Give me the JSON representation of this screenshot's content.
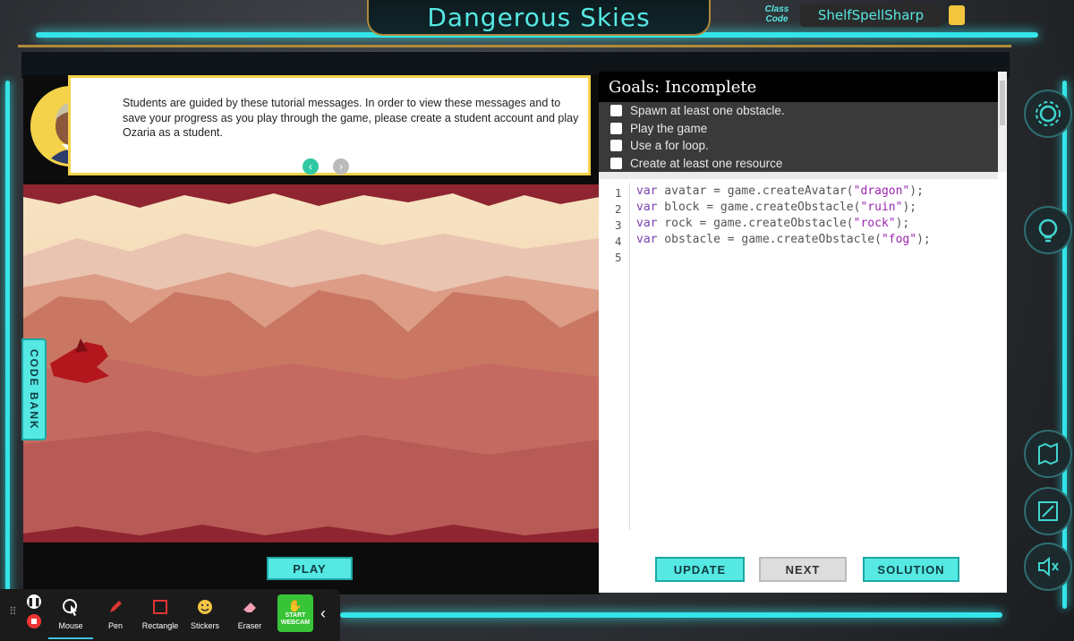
{
  "header": {
    "title": "Dangerous Skies",
    "class_code_label": "Class Code",
    "class_code": "ShelfSpellSharp"
  },
  "tutorial": {
    "message": "Students are guided by these tutorial messages. In order to view these messages and to save your progress as you play through the game, please create a student account and play Ozaria as a student."
  },
  "game": {
    "code_bank_label": "CODE BANK",
    "play_label": "PLAY"
  },
  "goals": {
    "heading": "Goals: Incomplete",
    "items": [
      "Spawn at least one obstacle.",
      "Play the game",
      "Use a for loop.",
      "Create at least one resource"
    ]
  },
  "code": {
    "line_numbers": [
      "1",
      "2",
      "3",
      "4",
      "5"
    ],
    "lines": [
      {
        "kw": "var",
        "rest": " avatar = game.createAvatar(",
        "str": "\"dragon\"",
        "end": ");"
      },
      {
        "kw": "var",
        "rest": " block = game.createObstacle(",
        "str": "\"ruin\"",
        "end": ");"
      },
      {
        "kw": "var",
        "rest": " rock = game.createObstacle(",
        "str": "\"rock\"",
        "end": ");"
      },
      {
        "kw": "var",
        "rest": " obstacle = game.createObstacle(",
        "str": "\"fog\"",
        "end": ");"
      }
    ]
  },
  "editor_buttons": {
    "update": "UPDATE",
    "next": "NEXT",
    "solution": "SOLUTION"
  },
  "toolbar": {
    "tools": [
      "Mouse",
      "Pen",
      "Rectangle",
      "Stickers",
      "Eraser"
    ],
    "webcam_line1": "START",
    "webcam_line2": "WEBCAM"
  },
  "icons": {
    "settings": "gear-icon",
    "hint": "lightbulb-icon",
    "map": "map-icon",
    "fullscreen": "fullscreen-icon",
    "mute": "speaker-muted-icon"
  },
  "colors": {
    "accent": "#56e8e3",
    "gold": "#b08a3a",
    "goal_panel": "#3a3a3a"
  }
}
